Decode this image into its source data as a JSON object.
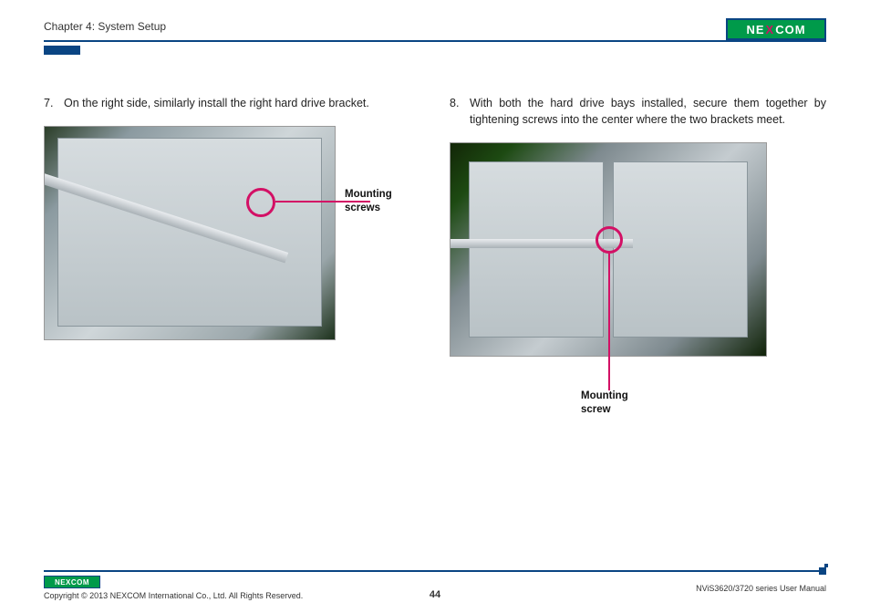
{
  "header": {
    "chapter": "Chapter 4: System Setup",
    "logo_text_left": "NE",
    "logo_text_x": "X",
    "logo_text_right": "COM"
  },
  "left_column": {
    "step_number": "7.",
    "step_text": "On the right side, similarly install the right hard drive bracket.",
    "callout_line1": "Mounting",
    "callout_line2": "screws"
  },
  "right_column": {
    "step_number": "8.",
    "step_text": "With both the hard drive bays installed, secure them together by tightening screws into the center where the two brackets meet.",
    "callout_line1": "Mounting",
    "callout_line2": "screw"
  },
  "footer": {
    "logo_text": "NEXCOM",
    "copyright": "Copyright © 2013 NEXCOM International Co., Ltd. All Rights Reserved.",
    "page_number": "44",
    "manual_name": "NViS3620/3720 series User Manual"
  }
}
